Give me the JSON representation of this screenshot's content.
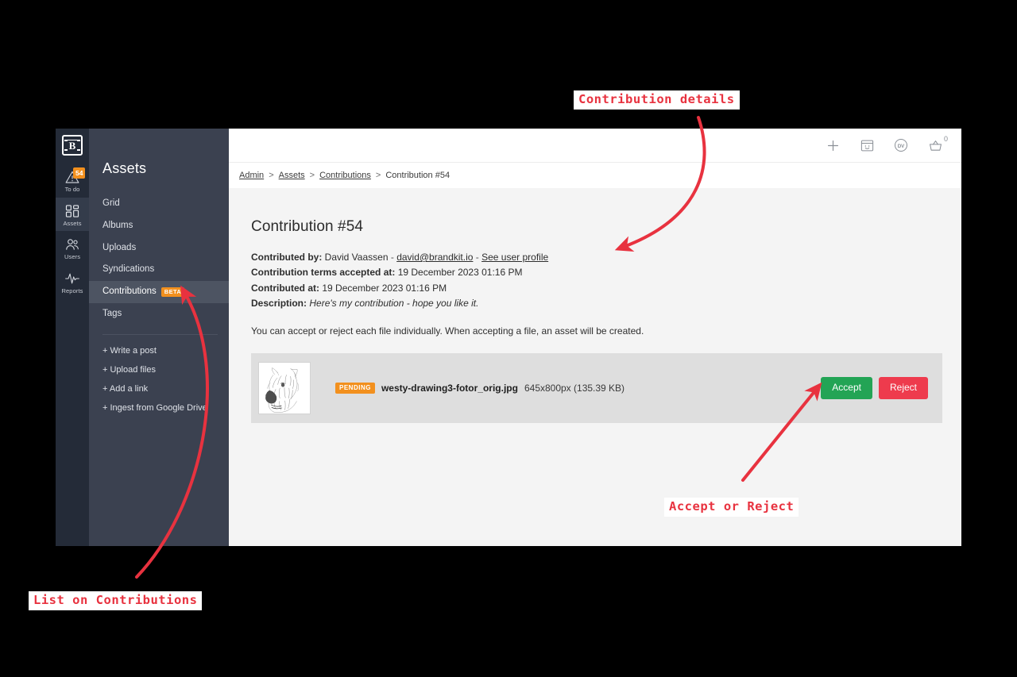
{
  "window": {
    "rail": {
      "logo_letter": "B",
      "items": [
        {
          "label": "To do",
          "icon": "warning-triangle-icon",
          "badge": "54",
          "active": false
        },
        {
          "label": "Assets",
          "icon": "grid-blocks-icon",
          "badge": "",
          "active": true
        },
        {
          "label": "Users",
          "icon": "users-icon",
          "badge": "",
          "active": false
        },
        {
          "label": "Reports",
          "icon": "pulse-icon",
          "badge": "",
          "active": false
        }
      ]
    },
    "nav": {
      "title": "Assets",
      "items": [
        {
          "label": "Grid",
          "badge": "",
          "active": false
        },
        {
          "label": "Albums",
          "badge": "",
          "active": false
        },
        {
          "label": "Uploads",
          "badge": "",
          "active": false
        },
        {
          "label": "Syndications",
          "badge": "",
          "active": false
        },
        {
          "label": "Contributions",
          "badge": "BETA",
          "active": true
        },
        {
          "label": "Tags",
          "badge": "",
          "active": false
        }
      ],
      "actions": [
        "+ Write a post",
        "+ Upload files",
        "+ Add a link",
        "+ Ingest from Google Drive"
      ]
    },
    "topbar": {
      "icons": [
        {
          "name": "plus-icon",
          "badge": ""
        },
        {
          "name": "window-face-icon",
          "badge": ""
        },
        {
          "name": "avatar-dv-icon",
          "badge": "",
          "initials": "DV"
        },
        {
          "name": "basket-icon",
          "badge": "0"
        }
      ]
    },
    "breadcrumb": {
      "items": [
        {
          "label": "Admin",
          "link": true
        },
        {
          "label": "Assets",
          "link": true
        },
        {
          "label": "Contributions",
          "link": true
        },
        {
          "label": "Contribution #54",
          "link": false
        }
      ],
      "separator": ">"
    },
    "page": {
      "title": "Contribution #54",
      "meta": [
        {
          "label": "Contributed by:",
          "value": "David Vaassen",
          "dash1": "-",
          "email": "david@brandkit.io",
          "dash2": "-",
          "profile_link": "See user profile"
        },
        {
          "label": "Contribution terms accepted at:",
          "value": "19 December 2023 01:16 PM"
        },
        {
          "label": "Contributed at:",
          "value": "19 December 2023 01:16 PM"
        },
        {
          "label": "Description:",
          "value": "Here's my contribution - hope you like it."
        }
      ],
      "helper_text": "You can accept or reject each file individually. When accepting a file, an asset will be created.",
      "file": {
        "status": "PENDING",
        "name": "westy-drawing3-fotor_orig.jpg",
        "dimensions": "645x800px (135.39 KB)",
        "thumbnail_alt": "pencil-sketch-west-highland-terrier-dog",
        "accept_label": "Accept",
        "reject_label": "Reject"
      }
    }
  },
  "annotations": {
    "contribution_details": "Contribution details",
    "accept_or_reject": "Accept or Reject",
    "list_on_contributions": "List on Contributions",
    "color": "#e8323f"
  }
}
